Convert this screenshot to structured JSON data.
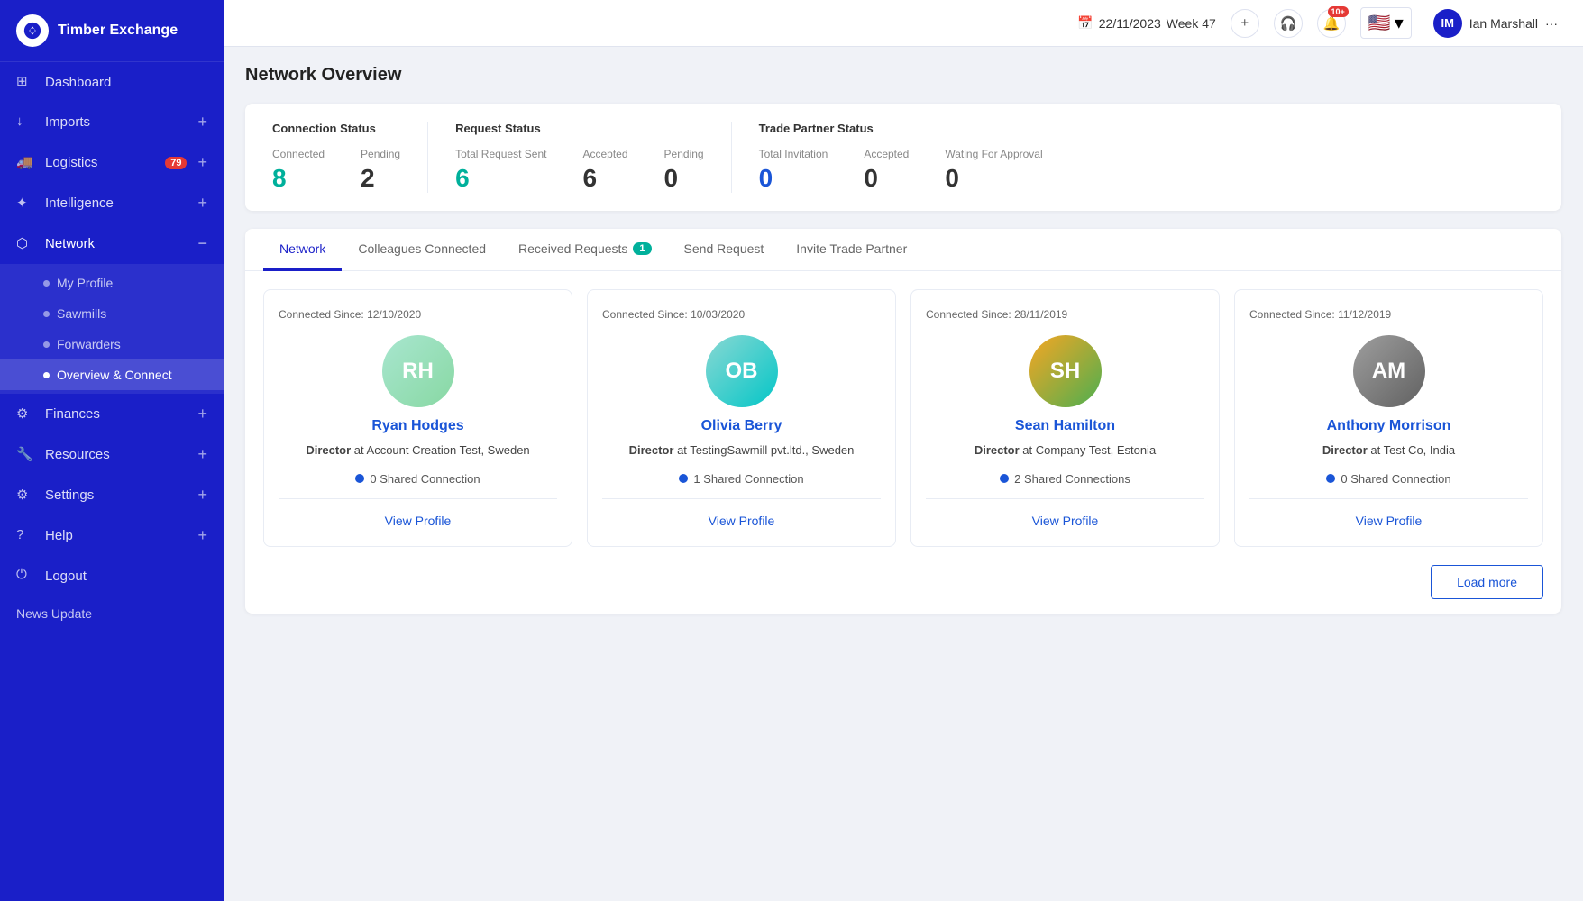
{
  "app": {
    "logo_text": "Timber Exchange",
    "date": "22/11/2023",
    "week": "Week 47",
    "user_name": "Ian Marshall",
    "user_initials": "IM",
    "notif_count": "10+"
  },
  "sidebar": {
    "items": [
      {
        "id": "dashboard",
        "label": "Dashboard",
        "icon": "grid"
      },
      {
        "id": "imports",
        "label": "Imports",
        "icon": "download",
        "action": "expand"
      },
      {
        "id": "logistics",
        "label": "Logistics",
        "icon": "truck",
        "badge": "79",
        "action": "expand"
      },
      {
        "id": "intelligence",
        "label": "Intelligence",
        "icon": "brain",
        "action": "expand"
      },
      {
        "id": "network",
        "label": "Network",
        "icon": "network",
        "action": "collapse",
        "active": true
      }
    ],
    "network_subnav": [
      {
        "id": "my-profile",
        "label": "My Profile"
      },
      {
        "id": "sawmills",
        "label": "Sawmills"
      },
      {
        "id": "forwarders",
        "label": "Forwarders"
      },
      {
        "id": "overview-connect",
        "label": "Overview & Connect",
        "active": true
      }
    ],
    "bottom_items": [
      {
        "id": "finances",
        "label": "Finances",
        "icon": "dollar",
        "action": "expand"
      },
      {
        "id": "resources",
        "label": "Resources",
        "icon": "tools",
        "action": "expand"
      },
      {
        "id": "settings",
        "label": "Settings",
        "icon": "gear",
        "action": "expand"
      },
      {
        "id": "help",
        "label": "Help",
        "icon": "question",
        "action": "expand"
      },
      {
        "id": "logout",
        "label": "Logout",
        "icon": "power"
      }
    ],
    "news_update": "News Update"
  },
  "page": {
    "title": "Network Overview"
  },
  "stats": {
    "connection_status": {
      "label": "Connection Status",
      "connected": {
        "label": "Connected",
        "value": "8"
      },
      "pending": {
        "label": "Pending",
        "value": "2"
      }
    },
    "request_status": {
      "label": "Request Status",
      "total_sent": {
        "label": "Total Request Sent",
        "value": "6"
      },
      "accepted": {
        "label": "Accepted",
        "value": "6"
      },
      "pending": {
        "label": "Pending",
        "value": "0"
      }
    },
    "trade_partner_status": {
      "label": "Trade Partner Status",
      "total_invitation": {
        "label": "Total Invitation",
        "value": "0"
      },
      "accepted": {
        "label": "Accepted",
        "value": "0"
      },
      "waiting": {
        "label": "Wating For Approval",
        "value": "0"
      }
    }
  },
  "tabs": [
    {
      "id": "network",
      "label": "Network",
      "active": true
    },
    {
      "id": "colleagues",
      "label": "Colleagues Connected"
    },
    {
      "id": "received",
      "label": "Received Requests",
      "badge": "1"
    },
    {
      "id": "send",
      "label": "Send Request"
    },
    {
      "id": "invite",
      "label": "Invite Trade Partner"
    }
  ],
  "connections": [
    {
      "initials": "RH",
      "name": "Ryan Hodges",
      "role": "Director",
      "company": "Account Creation Test, Sweden",
      "connected_since": "Connected Since: 12/10/2020",
      "shared_connections": "0 Shared Connection",
      "avatar_class": "avatar-rh",
      "view_label": "View Profile"
    },
    {
      "initials": "OB",
      "name": "Olivia Berry",
      "role": "Director",
      "company": "TestingSawmill pvt.ltd., Sweden",
      "connected_since": "Connected Since: 10/03/2020",
      "shared_connections": "1 Shared Connection",
      "avatar_class": "avatar-ob",
      "view_label": "View Profile"
    },
    {
      "initials": "SH",
      "name": "Sean Hamilton",
      "role": "Director",
      "company": "Company Test, Estonia",
      "connected_since": "Connected Since: 28/11/2019",
      "shared_connections": "2 Shared Connections",
      "avatar_class": "avatar-sh",
      "view_label": "View Profile"
    },
    {
      "initials": "AM",
      "name": "Anthony Morrison",
      "role": "Director",
      "company": "Test Co, India",
      "connected_since": "Connected Since: 11/12/2019",
      "shared_connections": "0 Shared Connection",
      "avatar_class": "avatar-am",
      "view_label": "View Profile"
    }
  ],
  "load_more": "Load more"
}
